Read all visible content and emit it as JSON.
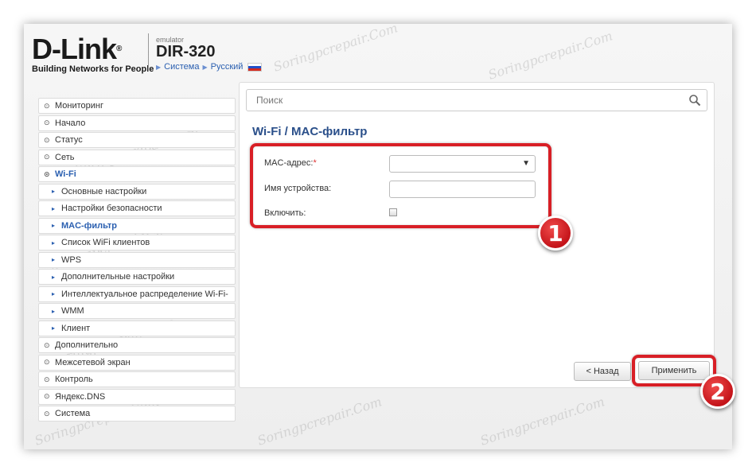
{
  "header": {
    "brand": "D-Link",
    "brand_mark": "®",
    "tagline": "Building Networks for People",
    "emulator": "emulator",
    "model": "DIR-320",
    "link_system": "Система",
    "link_language": "Русский"
  },
  "search": {
    "placeholder": "Поиск"
  },
  "sidebar": {
    "items": [
      {
        "label": "Мониторинг"
      },
      {
        "label": "Начало"
      },
      {
        "label": "Статус"
      },
      {
        "label": "Сеть"
      },
      {
        "label": "Wi-Fi"
      },
      {
        "label": "Основные настройки"
      },
      {
        "label": "Настройки безопасности"
      },
      {
        "label": "MAC-фильтр"
      },
      {
        "label": "Список WiFi клиентов"
      },
      {
        "label": "WPS"
      },
      {
        "label": "Дополнительные настройки"
      },
      {
        "label": "Интеллектуальное распределение Wi-Fi-"
      },
      {
        "label": "WMM"
      },
      {
        "label": "Клиент"
      },
      {
        "label": "Дополнительно"
      },
      {
        "label": "Межсетевой экран"
      },
      {
        "label": "Контроль"
      },
      {
        "label": "Яндекс.DNS"
      },
      {
        "label": "Система"
      }
    ]
  },
  "main": {
    "title": "Wi-Fi /  MAC-фильтр",
    "form": {
      "mac_label": "MAC-адрес:",
      "mac_required": "*",
      "mac_value": "",
      "device_label": "Имя устройства:",
      "device_value": "",
      "enable_label": "Включить:",
      "enable_checked": false
    },
    "back_button": "< Назад",
    "apply_button": "Применить"
  },
  "annotations": {
    "badge1": "1",
    "badge2": "2",
    "highlight_color": "#d81f26"
  },
  "watermark": "Soringpcrepair.Com"
}
